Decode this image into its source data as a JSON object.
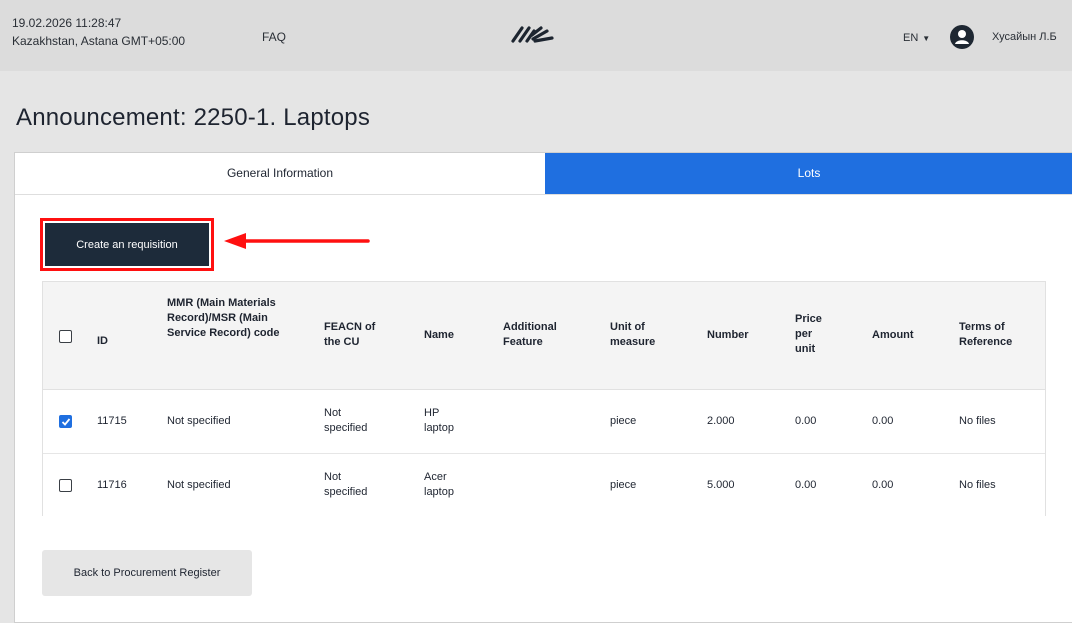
{
  "header": {
    "datetime": "19.02.2026 11:28:47",
    "timezone": "Kazakhstan, Astana GMT+05:00",
    "faq": "FAQ",
    "language": "EN",
    "user_name": "Хусайын Л.Б",
    "logo_icon": "brand-logo-icon",
    "avatar_icon": "user-avatar-icon"
  },
  "page": {
    "title": "Announcement: 2250-1. Laptops"
  },
  "tabs": [
    {
      "label": "General Information",
      "active": false
    },
    {
      "label": "Lots",
      "active": true
    }
  ],
  "actions": {
    "create_requisition": "Create an requisition",
    "back": "Back to Procurement Register"
  },
  "table": {
    "columns": {
      "id": "ID",
      "mmr": "MMR (Main Materials Record)/MSR (Main Service Record) code",
      "feacn": "FEACN of the CU",
      "name": "Name",
      "additional": "Additional Feature",
      "unit": "Unit of measure",
      "number": "Number",
      "price": "Price per unit",
      "amount": "Amount",
      "terms": "Terms of Reference"
    },
    "rows": [
      {
        "checked": true,
        "id": "11715",
        "mmr": "Not specified",
        "feacn": "Not specified",
        "name": "HP laptop",
        "additional": "",
        "unit": "piece",
        "number": "2.000",
        "price": "0.00",
        "amount": "0.00",
        "terms": "No files"
      },
      {
        "checked": false,
        "id": "11716",
        "mmr": "Not specified",
        "feacn": "Not specified",
        "name": "Acer laptop",
        "additional": "",
        "unit": "piece",
        "number": "5.000",
        "price": "0.00",
        "amount": "0.00",
        "terms": "No files"
      }
    ]
  },
  "colors": {
    "accent": "#1f6fe0",
    "primary_button": "#1d2b3a",
    "highlight": "#ff1010"
  }
}
